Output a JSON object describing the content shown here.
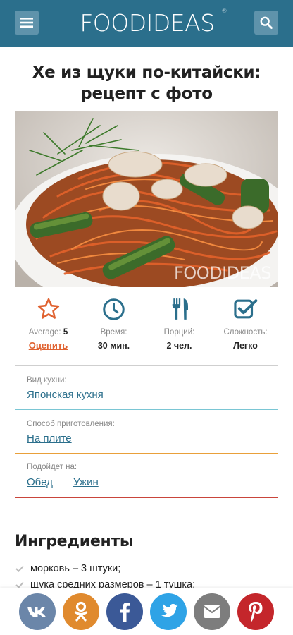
{
  "header": {
    "logo_text": "FOODIDEAS",
    "logo_mark": "®",
    "menu_icon": "hamburger-icon",
    "search_icon": "search-icon"
  },
  "recipe": {
    "title": "Хе из щуки по-китайски: рецепт с фото",
    "photo_watermark": "FOODIDEAS"
  },
  "stats": {
    "rating": {
      "icon": "star-icon",
      "label": "Average:",
      "value": "5",
      "action": "Оценить"
    },
    "time": {
      "icon": "clock-icon",
      "label": "Время:",
      "value": "30 мин."
    },
    "portions": {
      "icon": "cutlery-icon",
      "label": "Порций:",
      "value": "2 чел."
    },
    "difficulty": {
      "icon": "checkbox-icon",
      "label": "Сложность:",
      "value": "Легко"
    }
  },
  "info": {
    "cuisine": {
      "label": "Вид кухни:",
      "links": [
        "Японская кухня"
      ]
    },
    "method": {
      "label": "Способ приготовления:",
      "links": [
        "На плите"
      ]
    },
    "suits": {
      "label": "Подойдет на:",
      "links": [
        "Обед",
        "Ужин"
      ]
    }
  },
  "ingredients": {
    "heading": "Ингредиенты",
    "items": [
      "морковь – 3 штуки;",
      "щука средних размеров – 1 тушка;"
    ]
  },
  "share": [
    {
      "name": "vk",
      "icon": "vk-icon",
      "color": "#6b86a9",
      "text": "vk"
    },
    {
      "name": "odnoklassniki",
      "icon": "odnoklassniki-icon",
      "color": "#e08a2e"
    },
    {
      "name": "facebook",
      "icon": "facebook-icon",
      "color": "#3b5997",
      "text": "f"
    },
    {
      "name": "twitter",
      "icon": "twitter-icon",
      "color": "#2fa3e6"
    },
    {
      "name": "email",
      "icon": "email-icon",
      "color": "#7d7d7d"
    },
    {
      "name": "pinterest",
      "icon": "pinterest-icon",
      "color": "#c4262b",
      "text": "P"
    }
  ],
  "colors": {
    "header_bg": "#2b6f8c",
    "accent_orange": "#e06230",
    "link_blue": "#2b6f8c",
    "separator_cuisine": "#7ac6d4",
    "separator_method": "#e9a03a",
    "separator_suits": "#c9453b"
  }
}
